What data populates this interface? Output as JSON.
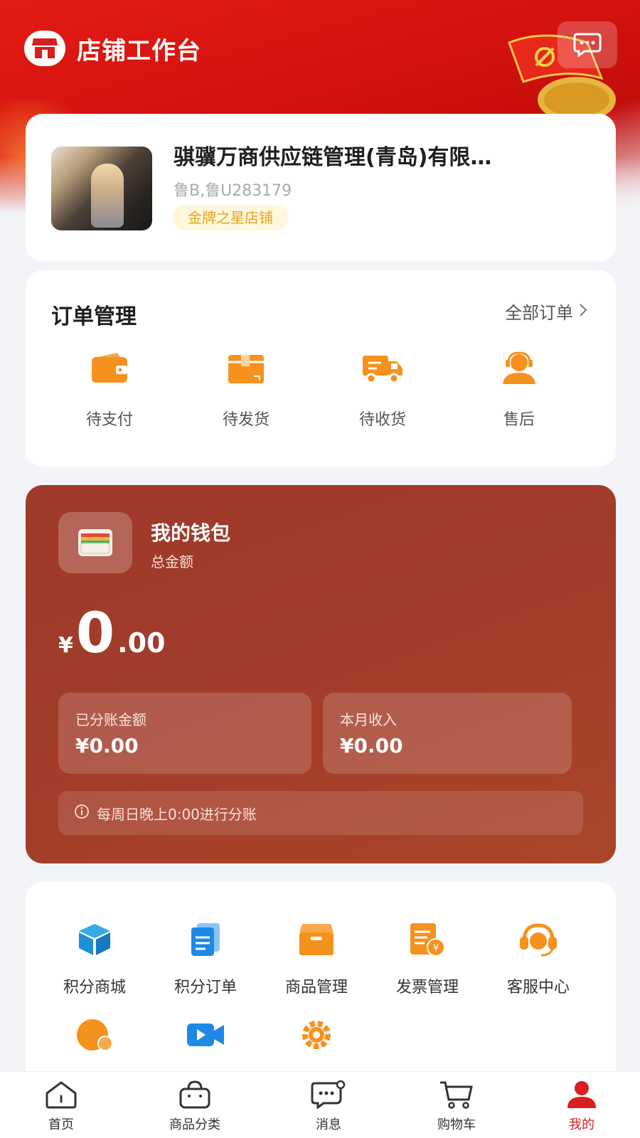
{
  "header": {
    "title": "店铺工作台",
    "logo_icon": "store-icon",
    "message_icon": "chat-bubble-icon"
  },
  "store": {
    "name": "骐骥万商供应链管理(青岛)有限…",
    "plate": "鲁B,鲁U283179",
    "badge": "金牌之星店铺"
  },
  "orders": {
    "title": "订单管理",
    "see_all": "全部订单",
    "items": [
      {
        "label": "待支付",
        "icon": "wallet-icon"
      },
      {
        "label": "待发货",
        "icon": "package-icon"
      },
      {
        "label": "待收货",
        "icon": "truck-icon"
      },
      {
        "label": "售后",
        "icon": "customer-service-icon"
      }
    ]
  },
  "wallet": {
    "title": "我的钱包",
    "subtitle": "总金额",
    "currency": "¥",
    "amount_int": "0",
    "amount_dec": ".00",
    "split_label": "已分账金额",
    "split_value": "¥0.00",
    "month_label": "本月收入",
    "month_value": "¥0.00",
    "notice": "每周日晚上0:00进行分账"
  },
  "tools": [
    {
      "label": "积分商城",
      "icon": "cube-icon"
    },
    {
      "label": "积分订单",
      "icon": "document-icon"
    },
    {
      "label": "商品管理",
      "icon": "box-icon"
    },
    {
      "label": "发票管理",
      "icon": "invoice-icon"
    },
    {
      "label": "客服中心",
      "icon": "headset-icon"
    }
  ],
  "tabs": [
    {
      "label": "首页",
      "icon": "home-icon"
    },
    {
      "label": "商品分类",
      "icon": "bag-icon"
    },
    {
      "label": "消息",
      "icon": "message-icon"
    },
    {
      "label": "购物车",
      "icon": "cart-icon"
    },
    {
      "label": "我的",
      "icon": "user-icon"
    }
  ],
  "colors": {
    "brand_red": "#e21b14",
    "accent_orange": "#f5921e",
    "wallet_bg": "#a33c2a",
    "active_tab": "#d81e1e"
  }
}
